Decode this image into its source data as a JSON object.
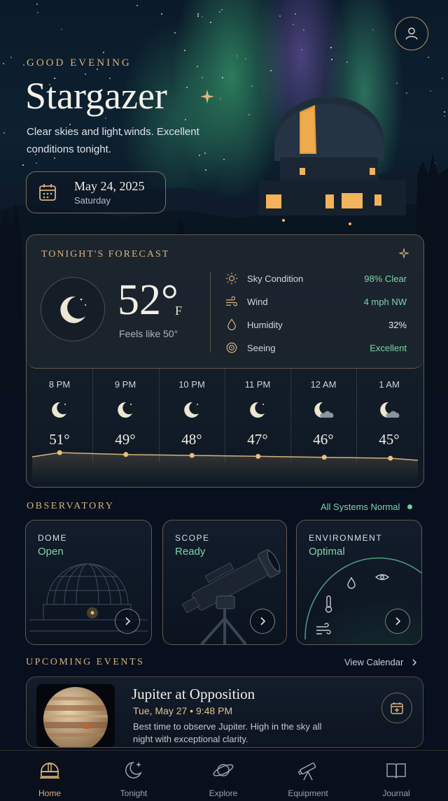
{
  "header": {
    "greeting": "GOOD EVENING",
    "title": "Stargazer",
    "subtitle": "Clear skies and light winds. Excellent conditions tonight.",
    "date": "May 24, 2025",
    "weekday": "Saturday",
    "profile_icon": "user-icon"
  },
  "forecast": {
    "label": "TONIGHT'S FORECAST",
    "temperature": "52°",
    "unit": "F",
    "feels_like": "Feels like 50°",
    "conditions": [
      {
        "icon": "sun-icon",
        "label": "Sky Condition",
        "value": "98% Clear"
      },
      {
        "icon": "wind-icon",
        "label": "Wind",
        "value": "4 mph NW"
      },
      {
        "icon": "droplet-icon",
        "label": "Humidity",
        "value": "32%"
      },
      {
        "icon": "target-icon",
        "label": "Seeing",
        "value": "Excellent"
      }
    ],
    "hourly": [
      {
        "time": "8 PM",
        "temp": "51°",
        "icon": "moon-icon"
      },
      {
        "time": "9 PM",
        "temp": "49°",
        "icon": "moon-icon"
      },
      {
        "time": "10 PM",
        "temp": "48°",
        "icon": "moon-icon"
      },
      {
        "time": "11 PM",
        "temp": "47°",
        "icon": "moon-icon"
      },
      {
        "time": "12 AM",
        "temp": "46°",
        "icon": "moon-cloud-icon"
      },
      {
        "time": "1 AM",
        "temp": "45°",
        "icon": "moon-cloud-icon"
      }
    ]
  },
  "observatory": {
    "title": "OBSERVATORY",
    "status": "All Systems Normal",
    "cards": [
      {
        "label": "DOME",
        "value": "Open"
      },
      {
        "label": "SCOPE",
        "value": "Ready"
      },
      {
        "label": "ENVIRONMENT",
        "value": "Optimal"
      }
    ]
  },
  "events": {
    "title": "UPCOMING EVENTS",
    "link": "View Calendar",
    "items": [
      {
        "title": "Jupiter at Opposition",
        "time": "Tue, May 27  •  9:48 PM",
        "description": "Best time to observe Jupiter. High in the sky all night with exceptional clarity."
      }
    ]
  },
  "nav": [
    {
      "label": "Home",
      "icon": "observatory-icon",
      "active": true
    },
    {
      "label": "Tonight",
      "icon": "moon-stars-icon"
    },
    {
      "label": "Explore",
      "icon": "planet-icon"
    },
    {
      "label": "Equipment",
      "icon": "telescope-icon"
    },
    {
      "label": "Journal",
      "icon": "book-icon"
    }
  ],
  "colors": {
    "gold": "#d7b27a",
    "green": "#7fd3a8",
    "background": "#08101f"
  }
}
